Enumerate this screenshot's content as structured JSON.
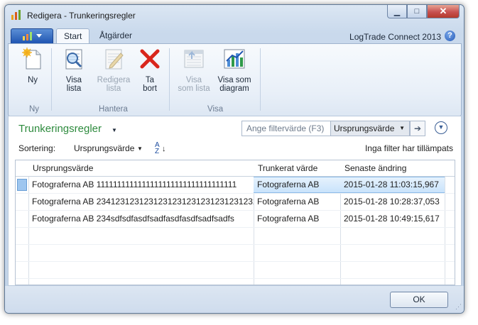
{
  "window": {
    "title": "Redigera - Trunkeringsregler",
    "controls": {
      "minimize": "▁",
      "maximize": "□",
      "close": "✕"
    }
  },
  "ribbon": {
    "tabs": [
      {
        "label": "Start",
        "active": true
      },
      {
        "label": "Åtgärder",
        "active": false
      }
    ],
    "brand": "LogTrade Connect 2013",
    "help_icon": "?",
    "groups": [
      {
        "label": "Ny",
        "buttons": [
          {
            "label": "Ny",
            "icon": "new-document-icon",
            "enabled": true
          }
        ]
      },
      {
        "label": "Hantera",
        "buttons": [
          {
            "label": "Visa lista",
            "line1": "Visa",
            "line2": "lista",
            "icon": "view-list-icon",
            "enabled": true
          },
          {
            "label": "Redigera lista",
            "line1": "Redigera",
            "line2": "lista",
            "icon": "edit-list-icon",
            "enabled": false
          },
          {
            "label": "Ta bort",
            "line1": "Ta",
            "line2": "bort",
            "icon": "delete-icon",
            "enabled": true
          }
        ]
      },
      {
        "label": "Visa",
        "buttons": [
          {
            "label": "Visa som lista",
            "line1": "Visa",
            "line2": "som lista",
            "icon": "view-as-list-icon",
            "enabled": false
          },
          {
            "label": "Visa som diagram",
            "line1": "Visa som",
            "line2": "diagram",
            "icon": "chart-icon",
            "enabled": true
          }
        ]
      }
    ]
  },
  "page": {
    "title": "Trunkeringsregler",
    "filter": {
      "placeholder": "Ange filtervärde (F3)",
      "field": "Ursprungsvärde"
    },
    "sorting": {
      "label": "Sortering:",
      "value": "Ursprungsvärde"
    },
    "filter_status": "Inga filter har tillämpats"
  },
  "table": {
    "columns": [
      "Ursprungsvärde",
      "Trunkerat värde",
      "Senaste ändring"
    ],
    "rows": [
      {
        "original": "Fotograferna AB 1111111111111111111111111111111111",
        "truncated": "Fotograferna AB",
        "modified": "2015-01-28 11:03:15,967",
        "selected": true
      },
      {
        "original": "Fotograferna AB 2341231231231231231231231231231232",
        "truncated": "Fotograferna AB",
        "modified": "2015-01-28 10:28:37,053",
        "selected": false
      },
      {
        "original": "Fotograferna AB 234sdfsdfasdfsadfasdfasdfsadfsadfs",
        "truncated": "Fotograferna AB",
        "modified": "2015-01-28 10:49:15,617",
        "selected": false
      }
    ]
  },
  "footer": {
    "ok_label": "OK"
  },
  "colors": {
    "title_green": "#2e8b3e",
    "selection": "#c9e3fb",
    "accent_blue": "#1f55b1",
    "delete_red": "#d9261c"
  }
}
